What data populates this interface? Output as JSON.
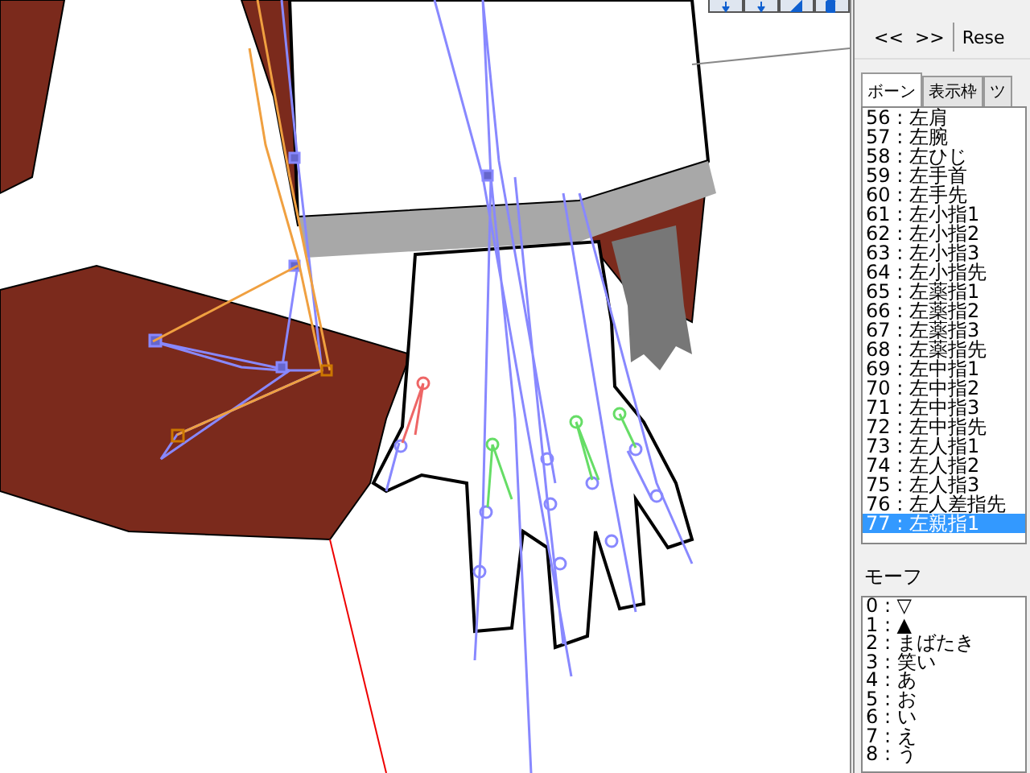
{
  "nav_buttons": [
    {
      "label": "<<"
    },
    {
      "label": ">>"
    },
    {
      "label": "Rese"
    }
  ],
  "tabs": [
    {
      "label": "ボーン",
      "selected": true
    },
    {
      "label": "表示枠",
      "selected": false
    },
    {
      "label": "ツ",
      "selected": false
    }
  ],
  "bones": [
    {
      "label": "56 : 左肩",
      "selected": false
    },
    {
      "label": "57 : 左腕",
      "selected": false
    },
    {
      "label": "58 : 左ひじ",
      "selected": false
    },
    {
      "label": "59 : 左手首",
      "selected": false
    },
    {
      "label": "60 : 左手先",
      "selected": false
    },
    {
      "label": "61 : 左小指1",
      "selected": false
    },
    {
      "label": "62 : 左小指2",
      "selected": false
    },
    {
      "label": "63 : 左小指3",
      "selected": false
    },
    {
      "label": "64 : 左小指先",
      "selected": false
    },
    {
      "label": "65 : 左薬指1",
      "selected": false
    },
    {
      "label": "66 : 左薬指2",
      "selected": false
    },
    {
      "label": "67 : 左薬指3",
      "selected": false
    },
    {
      "label": "68 : 左薬指先",
      "selected": false
    },
    {
      "label": "69 : 左中指1",
      "selected": false
    },
    {
      "label": "70 : 左中指2",
      "selected": false
    },
    {
      "label": "71 : 左中指3",
      "selected": false
    },
    {
      "label": "72 : 左中指先",
      "selected": false
    },
    {
      "label": "73 : 左人指1",
      "selected": false
    },
    {
      "label": "74 : 左人指2",
      "selected": false
    },
    {
      "label": "75 : 左人指3",
      "selected": false
    },
    {
      "label": "76 : 左人差指先",
      "selected": false
    },
    {
      "label": "77 : 左親指1",
      "selected": true
    }
  ],
  "morph_section": {
    "title": "モーフ"
  },
  "morphs": [
    {
      "label": "0 : ▽"
    },
    {
      "label": "1 : ▲"
    },
    {
      "label": "2 : まばたき"
    },
    {
      "label": "3 : 笑い"
    },
    {
      "label": "4 : あ"
    },
    {
      "label": "5 : お"
    },
    {
      "label": "6 : い"
    },
    {
      "label": "7 : え"
    },
    {
      "label": "8 : う"
    }
  ]
}
